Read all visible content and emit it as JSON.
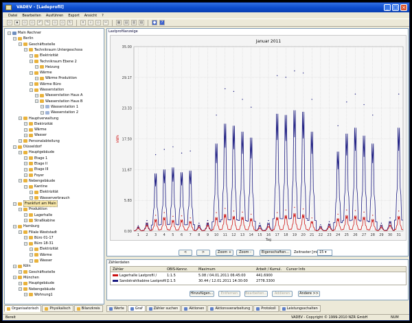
{
  "window": {
    "title": "VADEV - [Ladeprofil]"
  },
  "menu": [
    "Datei",
    "Bearbeiten",
    "Ausführen",
    "Export",
    "Ansicht",
    "?"
  ],
  "tree": [
    {
      "label": "Main Rechner",
      "depth": 0,
      "icon": "computer"
    },
    {
      "label": "Berlin",
      "depth": 1,
      "icon": "house"
    },
    {
      "label": "Geschäftsstelle",
      "depth": 2,
      "icon": "house"
    },
    {
      "label": "Technikraum Untergeschoss",
      "depth": 3,
      "icon": "house"
    },
    {
      "label": "Elektrizität",
      "depth": 4,
      "icon": "house"
    },
    {
      "label": "Technikraum Ebene 2",
      "depth": 4,
      "icon": "house"
    },
    {
      "label": "Heizung",
      "depth": 5,
      "icon": "house"
    },
    {
      "label": "Wärme",
      "depth": 4,
      "icon": "house"
    },
    {
      "label": "Wärme Produktion",
      "depth": 5,
      "icon": "house"
    },
    {
      "label": "Wärme Büro",
      "depth": 4,
      "icon": "house"
    },
    {
      "label": "Wasserstation",
      "depth": 4,
      "icon": "house"
    },
    {
      "label": "Wasserstation Haus A",
      "depth": 5,
      "icon": "house"
    },
    {
      "label": "Wasserstation Haus B",
      "depth": 5,
      "icon": "house"
    },
    {
      "label": "Wasserstation 1",
      "depth": 6,
      "icon": "meter"
    },
    {
      "label": "Wasserstation 2",
      "depth": 6,
      "icon": "meter"
    },
    {
      "label": "Hauptverwaltung",
      "depth": 2,
      "icon": "house"
    },
    {
      "label": "Elektrizität",
      "depth": 3,
      "icon": "house"
    },
    {
      "label": "Wärme",
      "depth": 3,
      "icon": "house"
    },
    {
      "label": "Wasser",
      "depth": 3,
      "icon": "house"
    },
    {
      "label": "Personalabteilung",
      "depth": 2,
      "icon": "house"
    },
    {
      "label": "Düsseldorf",
      "depth": 1,
      "icon": "house"
    },
    {
      "label": "Hauptgebäude",
      "depth": 2,
      "icon": "house"
    },
    {
      "label": "Etage 1",
      "depth": 3,
      "icon": "house"
    },
    {
      "label": "Etage II",
      "depth": 3,
      "icon": "house"
    },
    {
      "label": "Etage III",
      "depth": 3,
      "icon": "house"
    },
    {
      "label": "Foyer",
      "depth": 3,
      "icon": "house"
    },
    {
      "label": "Nebengebäude",
      "depth": 2,
      "icon": "house"
    },
    {
      "label": "Kantine",
      "depth": 3,
      "icon": "house"
    },
    {
      "label": "Elektrizität",
      "depth": 4,
      "icon": "house"
    },
    {
      "label": "Wasserverbrauch",
      "depth": 4,
      "icon": "house"
    },
    {
      "label": "Frankfurt am Main",
      "depth": 1,
      "icon": "house",
      "selected": true
    },
    {
      "label": "Produktion",
      "depth": 2,
      "icon": "house"
    },
    {
      "label": "Lagerhalle",
      "depth": 3,
      "icon": "house"
    },
    {
      "label": "Straßkabine",
      "depth": 3,
      "icon": "house"
    },
    {
      "label": "Hamburg",
      "depth": 1,
      "icon": "house"
    },
    {
      "label": "Filiale Weststadt",
      "depth": 2,
      "icon": "house"
    },
    {
      "label": "Büro 01-17",
      "depth": 3,
      "icon": "house"
    },
    {
      "label": "Büro 18-31",
      "depth": 3,
      "icon": "house"
    },
    {
      "label": "Elektrizität",
      "depth": 4,
      "icon": "house"
    },
    {
      "label": "Wärme",
      "depth": 4,
      "icon": "house"
    },
    {
      "label": "Wasser",
      "depth": 4,
      "icon": "house"
    },
    {
      "label": "Köln",
      "depth": 1,
      "icon": "house"
    },
    {
      "label": "Geschäftsstelle",
      "depth": 2,
      "icon": "house"
    },
    {
      "label": "München",
      "depth": 1,
      "icon": "house"
    },
    {
      "label": "Hauptgebäude",
      "depth": 2,
      "icon": "house"
    },
    {
      "label": "Nebengebäude",
      "depth": 2,
      "icon": "house"
    },
    {
      "label": "Wohnung1",
      "depth": 3,
      "icon": "house"
    }
  ],
  "left_tabs": [
    "Organisatorisch",
    "Physikalisch",
    "Bilanzkreis"
  ],
  "chart_panel": {
    "header": "Lastprofilanzeige"
  },
  "chart_data": {
    "type": "line",
    "title": "Januar 2011",
    "xlabel": "Tag",
    "ylabel": "kWh",
    "ylim": [
      0,
      35
    ],
    "yticks": [
      "0.00",
      "5.83",
      "11.67",
      "17.50",
      "23.33",
      "29.17",
      "35.00"
    ],
    "categories": [
      "1",
      "2",
      "3",
      "4",
      "5",
      "6",
      "7",
      "8",
      "9",
      "10",
      "11",
      "12",
      "13",
      "14",
      "15",
      "16",
      "17",
      "18",
      "19",
      "20",
      "21",
      "22",
      "23",
      "24",
      "25",
      "26",
      "27",
      "28",
      "29",
      "30",
      "31"
    ],
    "grid": true,
    "series": [
      {
        "name": "Lagerhalle Lastprofil /",
        "color": "#cc1111",
        "values": [
          0.8,
          1.5,
          3.0,
          3.5,
          2.8,
          2.9,
          2.5,
          1.0,
          1.5,
          3.5,
          4.3,
          3.8,
          3.6,
          3.2,
          0.8,
          1.2,
          3.5,
          4.0,
          4.5,
          4.2,
          2.5,
          0.8,
          1.2,
          3.2,
          4.0,
          3.9,
          3.6,
          3.0,
          1.0,
          1.5,
          3.8
        ]
      },
      {
        "name": "Sandstrahlkabine Lastprofil /",
        "color": "#1a1a80",
        "values": [
          1.0,
          2.0,
          14.5,
          15.5,
          16.0,
          14.8,
          15.2,
          1.5,
          2.0,
          22.0,
          27.0,
          26.5,
          25.0,
          23.5,
          1.5,
          2.0,
          29.5,
          29.2,
          30.4,
          30.0,
          25.0,
          1.2,
          1.8,
          20.0,
          24.5,
          26.0,
          24.0,
          22.0,
          1.5,
          2.5,
          26.0
        ]
      }
    ]
  },
  "nav": {
    "prev": "<",
    "next": ">",
    "zoom_in": "Zoom +",
    "zoom_out": "Zoom -",
    "properties": "Eigenschaften...",
    "interval_label": "Zeitraster [min]",
    "interval_value": "15"
  },
  "counters": {
    "header": "Zählerdaten",
    "columns": [
      "Zähler",
      "OBIS-Kennz.",
      "Maximum",
      "Arbeit / Kumul.",
      "Cursor Info"
    ],
    "rows": [
      {
        "name": "Lagerhalle Lastprofil /",
        "obis": "1:1.5",
        "maximum": "5.08 / 04.01.2011 06:45:00",
        "work": "441.6900",
        "cursor": "",
        "color": "#cc1111"
      },
      {
        "name": "Sandstrahlkabine Lastprofil /",
        "obis": "1:1.5",
        "maximum": "30.44 / 12.01.2011 14:30:00",
        "work": "2778.3300",
        "cursor": "",
        "color": "#1a1a80"
      }
    ],
    "buttons": [
      "Hinzufügen...",
      "Entfernen",
      "Bearbeiten...",
      "Addieren",
      "Andere >>"
    ]
  },
  "bottom_tabs": [
    "Werte",
    "Graf",
    "Zähler suchen",
    "Aktionen",
    "Aktionsverarbeitung",
    "Protokoll",
    "Leistungsschalten"
  ],
  "status": {
    "left": "Bereit",
    "right": "VADEV - Copyright © 1999-2010 NZR GmbH",
    "num": "NUM"
  }
}
